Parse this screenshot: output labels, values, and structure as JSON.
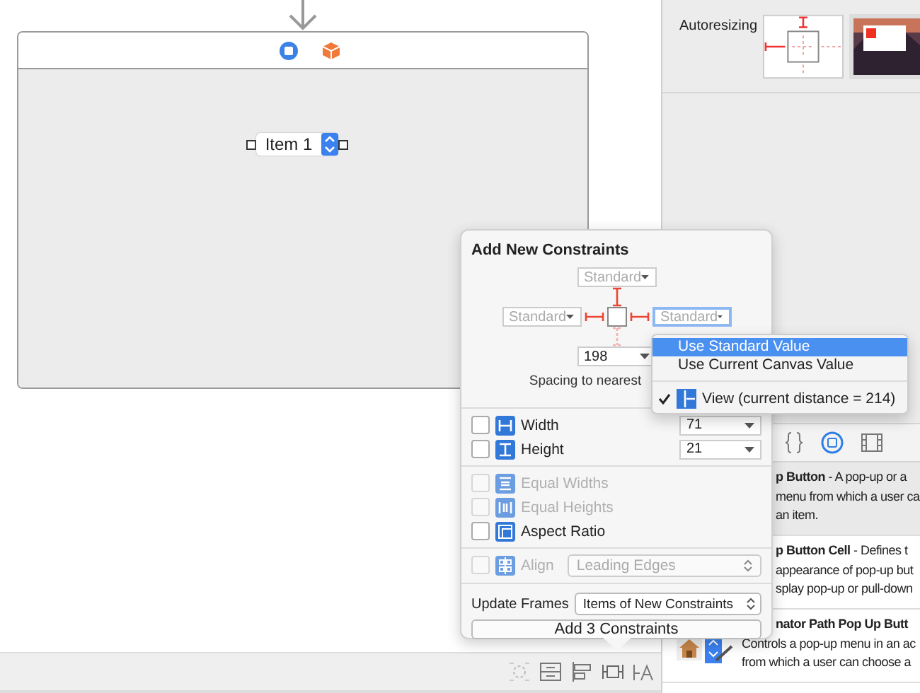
{
  "canvas": {
    "popup_button": {
      "value": "Item 1"
    }
  },
  "inspector": {
    "autoresizing_label": "Autoresizing"
  },
  "library": {
    "items": [
      {
        "kind": "text",
        "selected": true,
        "lines": [
          "**p Button** - A pop-up or a",
          "menu from which a user ca",
          "an item."
        ]
      },
      {
        "kind": "text",
        "selected": false,
        "lines": [
          "**p Button Cell** - Defines t",
          "appearance of pop-up but",
          "splay pop-up or pull-down"
        ]
      },
      {
        "kind": "icon-row",
        "selected": false,
        "lines": [
          "**nator Path Pop Up Butt**",
          "Controls a pop-up menu in an ac",
          "from which a user can choose a"
        ]
      }
    ]
  },
  "constraints_popover": {
    "title": "Add New Constraints",
    "top": {
      "placeholder": "Standard",
      "pinned": true,
      "focused": false
    },
    "leading": {
      "placeholder": "Standard",
      "pinned": true,
      "focused": false
    },
    "trailing": {
      "placeholder": "Standard",
      "pinned": true,
      "focused": true
    },
    "bottom": {
      "value": "198",
      "pinned": false,
      "focused": false
    },
    "spacing_label": "Spacing to nearest",
    "row_groups": [
      {
        "rows": [
          {
            "kind": "width",
            "label": "Width",
            "checked": false,
            "disabled": false,
            "value": "71"
          },
          {
            "kind": "height",
            "label": "Height",
            "checked": false,
            "disabled": false,
            "value": "21"
          }
        ]
      },
      {
        "rows": [
          {
            "kind": "equal-widths",
            "label": "Equal Widths",
            "checked": false,
            "disabled": true
          },
          {
            "kind": "equal-heights",
            "label": "Equal Heights",
            "checked": false,
            "disabled": true
          },
          {
            "kind": "aspect",
            "label": "Aspect Ratio",
            "checked": false,
            "disabled": false
          }
        ]
      },
      {
        "rows": [
          {
            "kind": "align",
            "label": "Align",
            "checked": false,
            "disabled": true,
            "select": "Leading Edges"
          }
        ]
      }
    ],
    "update_frames_label": "Update Frames",
    "update_frames_value": "Items of New Constraints",
    "add_button": "Add 3 Constraints"
  },
  "menu": {
    "options": [
      {
        "label": "Use Standard Value",
        "selected": true
      },
      {
        "label": "Use Current Canvas Value",
        "selected": false
      }
    ],
    "view_item": {
      "label": "View (current distance = 214)",
      "checked": true
    }
  }
}
